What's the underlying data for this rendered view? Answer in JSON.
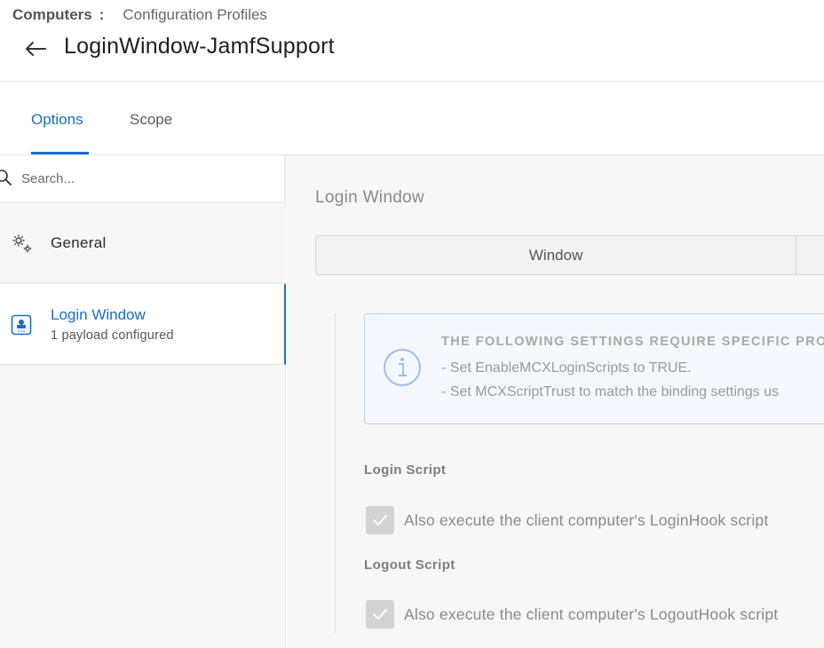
{
  "header": {
    "breadcrumb_root": "Computers",
    "breadcrumb_separator": ":",
    "breadcrumb_current": "Configuration Profiles",
    "title": "LoginWindow-JamfSupport",
    "back_icon": "arrow-left-icon"
  },
  "tabs": [
    {
      "label": "Options",
      "active": true
    },
    {
      "label": "Scope",
      "active": false
    }
  ],
  "sidebar": {
    "search": {
      "placeholder": "Search...",
      "value": ""
    },
    "items": [
      {
        "label": "General",
        "subtitle": "",
        "icon": "gears-icon",
        "selected": false
      },
      {
        "label": "Login Window",
        "subtitle": "1 payload configured",
        "icon": "login-window-icon",
        "selected": true
      }
    ]
  },
  "main": {
    "section_title": "Login Window",
    "subtabs": [
      {
        "label": "Window",
        "active": true
      }
    ],
    "info": {
      "icon": "info-icon",
      "heading": "THE FOLLOWING SETTINGS REQUIRE SPECIFIC PRO",
      "lines": [
        "- Set EnableMCXLoginScripts to TRUE.",
        "- Set MCXScriptTrust to match the binding settings us"
      ]
    },
    "login_script": {
      "label": "Login Script",
      "checkbox_label": "Also execute the client computer's LoginHook script",
      "checked": true
    },
    "logout_script": {
      "label": "Logout Script",
      "checkbox_label": "Also execute the client computer's LogoutHook script",
      "checked": true
    }
  },
  "colors": {
    "accent": "#1a6fc4",
    "sidebar_bg": "#f6f6f6",
    "info_border": "#bcd6ee",
    "disabled_text": "#8a8a8a"
  }
}
